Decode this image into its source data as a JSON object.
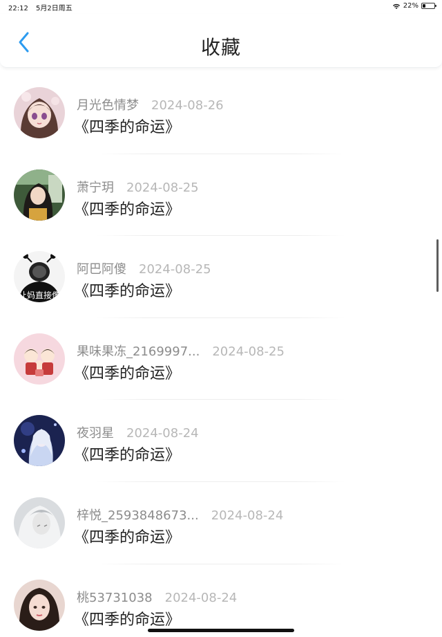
{
  "status": {
    "time": "22:12",
    "date": "5月2日周五",
    "battery": "22%",
    "battery_level": 0.22
  },
  "header": {
    "title": "收藏",
    "back_icon": "chevron-left-icon"
  },
  "colors": {
    "accent": "#2c9bf0",
    "name": "#8c8c8c",
    "date": "#b7b7b7",
    "title": "#222222"
  },
  "favorites": [
    {
      "user": "月光色情梦",
      "date": "2024-08-26",
      "title": "《四季的命运》"
    },
    {
      "user": "萧宁玥",
      "date": "2024-08-25",
      "title": "《四季的命运》"
    },
    {
      "user": "阿巴阿傻",
      "date": "2024-08-25",
      "title": "《四季的命运》",
      "avatar_text": "让妈直接像"
    },
    {
      "user": "果味果冻_2169997...",
      "date": "2024-08-25",
      "title": "《四季的命运》"
    },
    {
      "user": "夜羽星",
      "date": "2024-08-24",
      "title": "《四季的命运》"
    },
    {
      "user": "梓悦_2593848673...",
      "date": "2024-08-24",
      "title": "《四季的命运》"
    },
    {
      "user": "桃53731038",
      "date": "2024-08-24",
      "title": "《四季的命运》"
    }
  ]
}
